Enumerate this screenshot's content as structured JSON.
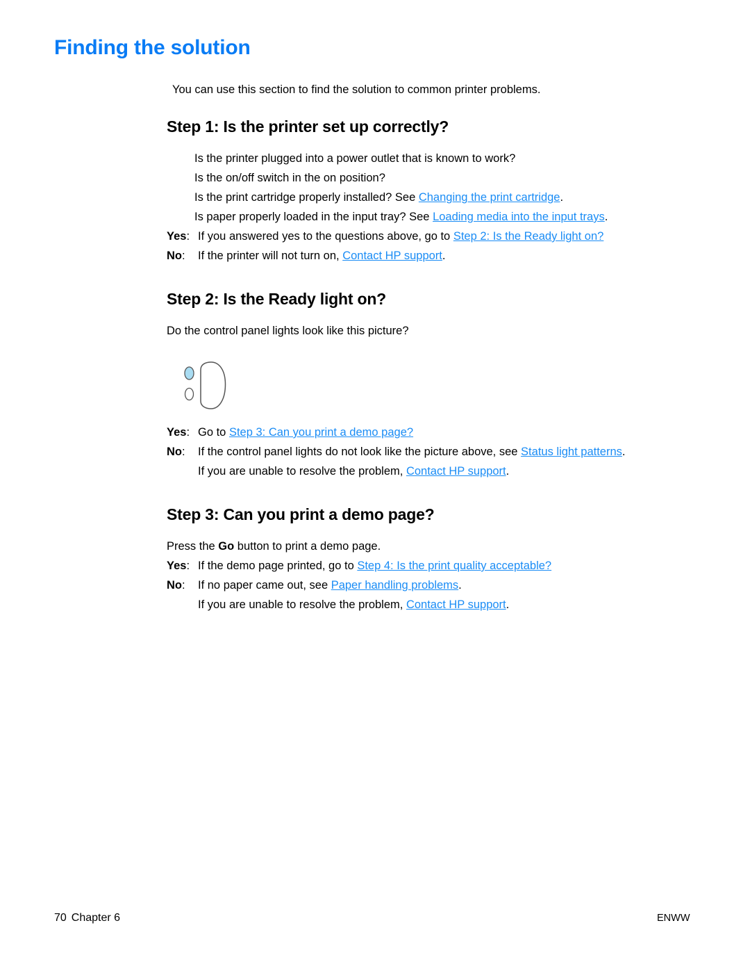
{
  "document": {
    "title": "Finding the solution",
    "title_color": "#0a7cf5",
    "link_color": "#1a8cf5",
    "intro": "You can use this section to find the solution to common printer problems."
  },
  "step1": {
    "heading": "Step 1: Is the printer set up correctly?",
    "q1": "Is the printer plugged into a power outlet that is known to work?",
    "q2": "Is the on/off switch in the on position?",
    "q3_pre": "Is the print cartridge properly installed? See ",
    "q3_link": "Changing the print cartridge",
    "q3_post": ".",
    "q4_pre": "Is paper properly loaded in the input tray? See ",
    "q4_link": "Loading media into the input trays",
    "q4_post": ".",
    "yes_label": "Yes",
    "yes_colon": ":",
    "yes_pre": "If you answered yes to the questions above, go to ",
    "yes_link": "Step 2: Is the Ready light on?",
    "yes_post": "",
    "no_label": "No",
    "no_colon": ":",
    "no_pre": "If the printer will not turn on, ",
    "no_link": "Contact HP support",
    "no_post": "."
  },
  "step2": {
    "heading": "Step 2: Is the Ready light on?",
    "question": "Do the control panel lights look like this picture?",
    "figure": {
      "name": "control-panel-lights",
      "ready_light_state": "on",
      "ready_light_color": "#a9dcf2",
      "attention_light_state": "off",
      "attention_light_color": "#ffffff",
      "outline_color": "#555555",
      "go_button_shape": "rounded-oval"
    },
    "yes_label": "Yes",
    "yes_colon": ":",
    "yes_pre": "Go to ",
    "yes_link": "Step 3: Can you print a demo page?",
    "yes_post": "",
    "no_label": "No",
    "no_colon": ":",
    "no_pre": "If the control panel lights do not look like the picture above, see ",
    "no_link": "Status light patterns",
    "no_post": ".",
    "cont_pre": "If you are unable to resolve the problem, ",
    "cont_link": "Contact HP support",
    "cont_post": "."
  },
  "step3": {
    "heading": "Step 3: Can you print a demo page?",
    "press_pre": "Press the ",
    "press_bold": "Go",
    "press_post": " button to print a demo page.",
    "yes_label": "Yes",
    "yes_colon": ":",
    "yes_pre": "If the demo page printed, go to ",
    "yes_link": "Step 4: Is the print quality acceptable?",
    "yes_post": "",
    "no_label": "No",
    "no_colon": ":",
    "no_pre": "If no paper came out, see ",
    "no_link": "Paper handling problems",
    "no_post": ".",
    "cont_pre": "If you are unable to resolve the problem, ",
    "cont_link": "Contact HP support",
    "cont_post": "."
  },
  "footer": {
    "page_number": "70",
    "chapter": "Chapter 6",
    "locale": "ENWW"
  }
}
